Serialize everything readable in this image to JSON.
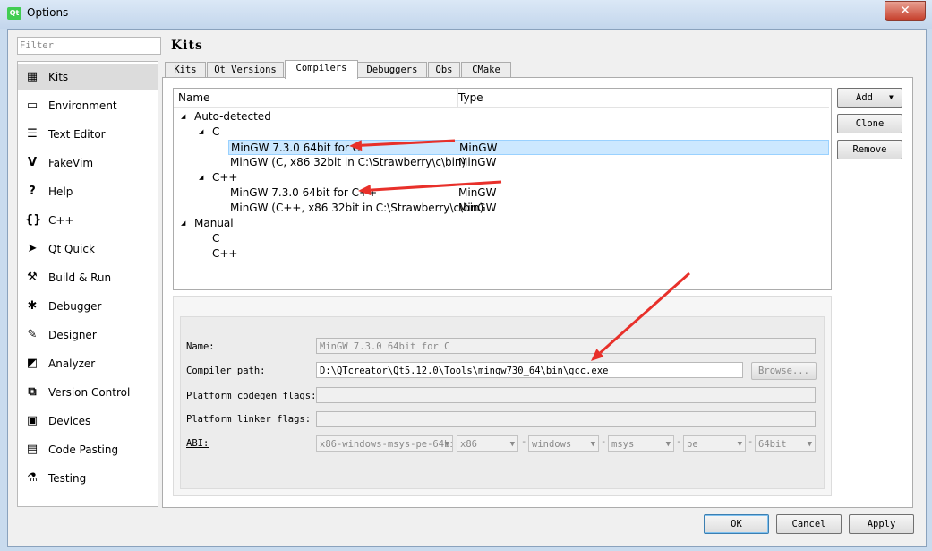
{
  "window": {
    "title": "Options",
    "app_icon": "Qt",
    "close": "✕"
  },
  "filter": {
    "placeholder": "Filter",
    "value": ""
  },
  "sidebar": {
    "items": [
      {
        "label": "Kits",
        "icon": "kits-icon",
        "glyph": "▦",
        "selected": true
      },
      {
        "label": "Environment",
        "icon": "monitor-icon",
        "glyph": "▭"
      },
      {
        "label": "Text Editor",
        "icon": "text-editor-icon",
        "glyph": "☰"
      },
      {
        "label": "FakeVim",
        "icon": "fakevim-icon",
        "glyph": "V"
      },
      {
        "label": "Help",
        "icon": "help-icon",
        "glyph": "?"
      },
      {
        "label": "C++",
        "icon": "braces-icon",
        "glyph": "{}"
      },
      {
        "label": "Qt Quick",
        "icon": "qt-quick-icon",
        "glyph": "➤"
      },
      {
        "label": "Build & Run",
        "icon": "hammer-icon",
        "glyph": "⚒"
      },
      {
        "label": "Debugger",
        "icon": "bug-icon",
        "glyph": "✱"
      },
      {
        "label": "Designer",
        "icon": "pencil-icon",
        "glyph": "✎"
      },
      {
        "label": "Analyzer",
        "icon": "analyzer-icon",
        "glyph": "◩"
      },
      {
        "label": "Version Control",
        "icon": "version-control-icon",
        "glyph": "⧉"
      },
      {
        "label": "Devices",
        "icon": "devices-icon",
        "glyph": "▣"
      },
      {
        "label": "Code Pasting",
        "icon": "clipboard-icon",
        "glyph": "▤"
      },
      {
        "label": "Testing",
        "icon": "flask-icon",
        "glyph": "⚗"
      }
    ]
  },
  "page": {
    "title": "Kits"
  },
  "tabs": [
    {
      "label": "Kits",
      "active": false
    },
    {
      "label": "Qt Versions",
      "active": false
    },
    {
      "label": "Compilers",
      "active": true
    },
    {
      "label": "Debuggers",
      "active": false
    },
    {
      "label": "Qbs",
      "active": false
    },
    {
      "label": "CMake",
      "active": false
    }
  ],
  "tree": {
    "columns": [
      "Name",
      "Type"
    ],
    "rows": [
      {
        "name": "Auto-detected",
        "type": "",
        "expander": "◢"
      },
      {
        "name": "C",
        "type": "",
        "expander": "◢"
      },
      {
        "name": "MinGW 7.3.0 64bit for C",
        "type": "MinGW",
        "selected": true
      },
      {
        "name": "MinGW (C, x86 32bit in C:\\Strawberry\\c\\bin)",
        "type": "MinGW"
      },
      {
        "name": "C++",
        "type": "",
        "expander": "◢"
      },
      {
        "name": "MinGW 7.3.0 64bit for C++",
        "type": "MinGW"
      },
      {
        "name": "MinGW (C++, x86 32bit in C:\\Strawberry\\c\\bin)",
        "type": "MinGW"
      },
      {
        "name": "Manual",
        "type": "",
        "expander": "◢"
      },
      {
        "name": "C",
        "type": ""
      },
      {
        "name": "C++",
        "type": ""
      }
    ]
  },
  "actions": {
    "add": "Add",
    "add_arrow": "▼",
    "clone": "Clone",
    "remove": "Remove"
  },
  "details": {
    "name_label": "Name:",
    "name_value": "MinGW 7.3.0 64bit for C",
    "path_label": "Compiler path:",
    "path_value": "D:\\QTcreator\\Qt5.12.0\\Tools\\mingw730_64\\bin\\gcc.exe",
    "browse": "Browse...",
    "codegen_label": "Platform codegen flags:",
    "codegen_value": "",
    "linker_label": "Platform linker flags:",
    "linker_value": "",
    "abi_label": "ABI:",
    "abi": {
      "main": "x86-windows-msys-pe-64bit",
      "arch": "x86",
      "os": "windows",
      "flavor": "msys",
      "format": "pe",
      "width": "64bit",
      "sep": "-"
    }
  },
  "footer": {
    "ok": "OK",
    "cancel": "Cancel",
    "apply": "Apply"
  },
  "annotation_color": "#e8302a"
}
